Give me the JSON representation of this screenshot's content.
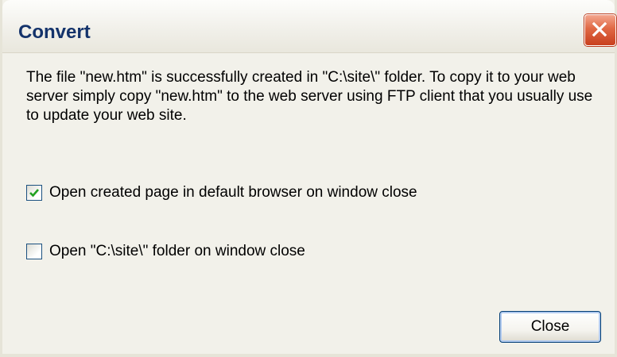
{
  "window": {
    "title": "Convert",
    "close_icon": "close-x-icon",
    "title_color": "#14336b",
    "close_button_color": "#e06844"
  },
  "message": "The file \"new.htm\" is successfully created in \"C:\\site\\\" folder. To copy it to your web server simply copy \"new.htm\" to the web server using FTP client that you usually use to update your web site.",
  "options": [
    {
      "label": "Open created page in default browser on window close",
      "checked": true
    },
    {
      "label": "Open \"C:\\site\\\" folder on window close",
      "checked": false
    }
  ],
  "buttons": {
    "close_label": "Close"
  }
}
